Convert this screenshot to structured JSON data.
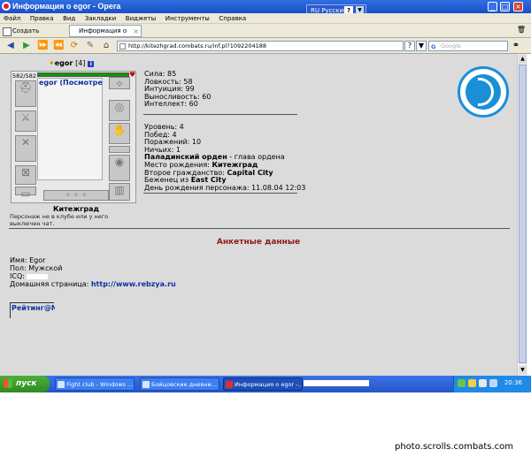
{
  "window": {
    "title": "Информация о egor - Opera",
    "language": "RU Русский"
  },
  "menu": [
    "Файл",
    "Правка",
    "Вид",
    "Закладки",
    "Виджеты",
    "Инструменты",
    "Справка"
  ],
  "tabs": {
    "new_tab": "Создать вкладку",
    "active": "Информация о egor"
  },
  "address": {
    "url": "http://kitezhgrad.combats.ru/inf.pl?1092204188",
    "search_placeholder": "Google"
  },
  "character": {
    "name": "egor",
    "level": "[4]",
    "hp": "582/582",
    "doll_link": "egor (Посмотре",
    "city": "Китежград",
    "club_note": "Персонаж не в клубе или у него выключен чат."
  },
  "stats": {
    "strength": "Сила: 85",
    "agility": "Ловкость: 58",
    "intuition": "Интуиция: 99",
    "endurance": "Выносливость: 60",
    "intellect": "Интеллект: 60",
    "level": "Уровень: 4",
    "wins": "Побед: 4",
    "losses": "Поражений: 10",
    "draws": "Ничьих: 1",
    "order_name": "Паладинский орден",
    "order_role": " - глава ордена",
    "birthplace_label": "Место рождения: ",
    "birthplace": "Китежград",
    "citizenship_label": "Второе гражданство: ",
    "citizenship": "Capital City",
    "refugee_label": "Беженец из ",
    "refugee": "East City",
    "birthday": "День рождения персонажа: 11.08.04 12:03"
  },
  "profile": {
    "title": "Анкетные данные",
    "name": "Имя: Egor",
    "sex": "Пол: Мужской",
    "icq": "ICQ: ",
    "homepage_label": "Домашняя страница: ",
    "homepage": "http://www.rebzya.ru",
    "rating": "Рейтинг@Mail.ru"
  },
  "taskbar": {
    "start": "пуск",
    "tasks": [
      "Fight club - Windows ...",
      "Бойцовские дневни...",
      "Информация о egor -..."
    ],
    "clock": "20:36"
  },
  "watermark": "photo.scrolls.combats.com"
}
